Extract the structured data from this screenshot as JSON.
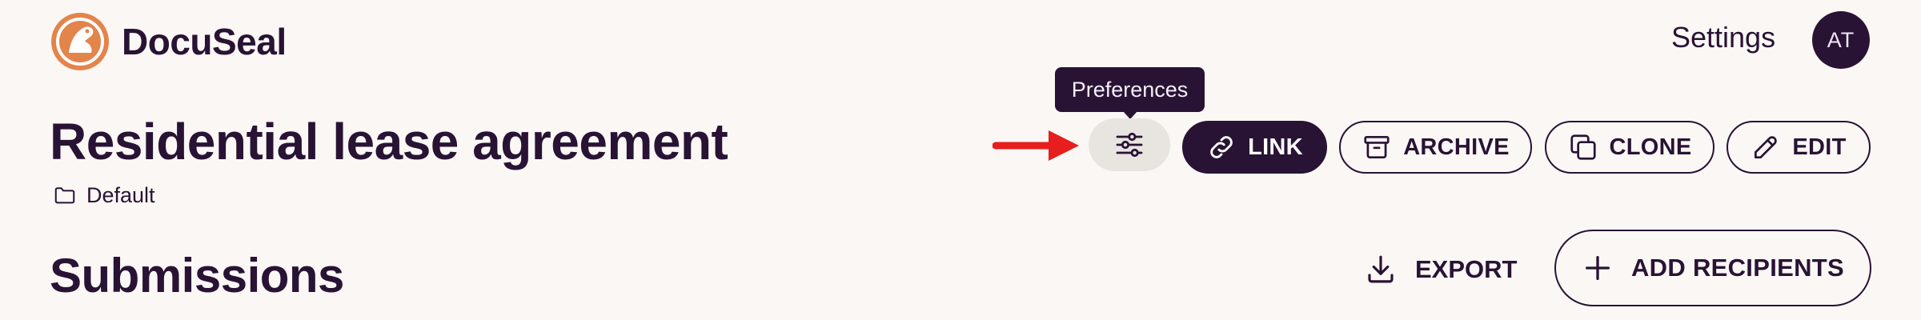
{
  "brand": {
    "name": "DocuSeal",
    "logo_icon": "docuseal-logo-icon",
    "logo_color": "#e3844b"
  },
  "header": {
    "settings_label": "Settings",
    "avatar_initials": "AT"
  },
  "template": {
    "title": "Residential lease agreement",
    "folder": "Default"
  },
  "tooltip": {
    "text": "Preferences"
  },
  "actions": {
    "link_label": "LINK",
    "archive_label": "ARCHIVE",
    "clone_label": "CLONE",
    "edit_label": "EDIT"
  },
  "submissions": {
    "title": "Submissions",
    "export_label": "EXPORT",
    "add_recipients_label": "ADD RECIPIENTS"
  },
  "colors": {
    "primary": "#291334",
    "background": "#faf7f5",
    "annotation": "#e61e1e"
  }
}
